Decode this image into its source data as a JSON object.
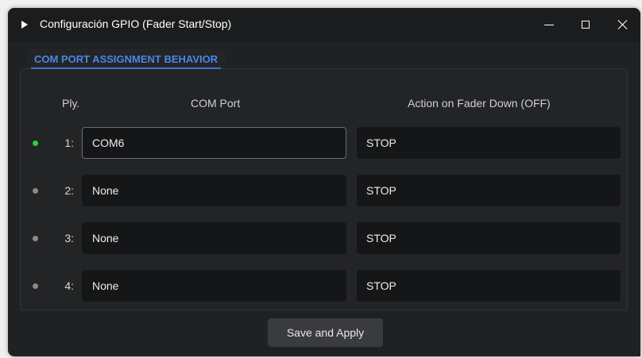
{
  "window": {
    "title": "Configuración GPIO (Fader Start/Stop)",
    "icon": "play-icon"
  },
  "tab": {
    "label": "COM PORT ASSIGNMENT  BEHAVIOR"
  },
  "headers": {
    "ply": "Ply.",
    "com_port": "COM Port",
    "action": "Action on Fader Down (OFF)"
  },
  "rows": [
    {
      "num": "1:",
      "com_port": "COM6",
      "action": "STOP",
      "status": "active",
      "status_color": "#2ecc40"
    },
    {
      "num": "2:",
      "com_port": "None",
      "action": "STOP",
      "status": "inactive",
      "status_color": "#8a8a8a"
    },
    {
      "num": "3:",
      "com_port": "None",
      "action": "STOP",
      "status": "inactive",
      "status_color": "#8a8a8a"
    },
    {
      "num": "4:",
      "com_port": "None",
      "action": "STOP",
      "status": "inactive",
      "status_color": "#8a8a8a"
    }
  ],
  "buttons": {
    "save": "Save and Apply"
  },
  "colors": {
    "accent": "#4a86e8",
    "background": "#202123",
    "field": "#151618"
  }
}
